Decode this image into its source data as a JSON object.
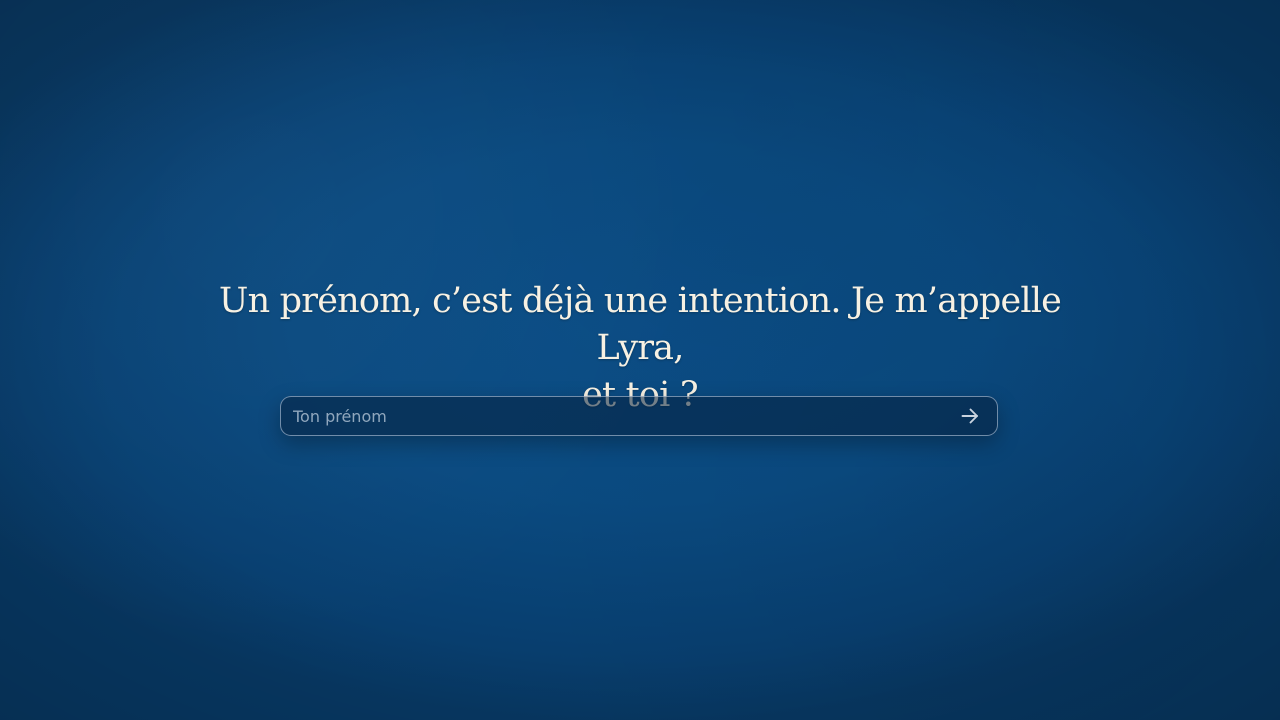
{
  "prompt": {
    "line1": "Un prénom, c’est déjà une intention. Je m’appelle Lyra,",
    "line2": "et toi ?"
  },
  "name_input": {
    "placeholder": "Ton prénom",
    "value": ""
  },
  "submit": {
    "icon": "arrow-right-icon"
  },
  "colors": {
    "background": "#0a4a80",
    "text": "#f7f1e3",
    "input_border": "#c8d7eb"
  }
}
